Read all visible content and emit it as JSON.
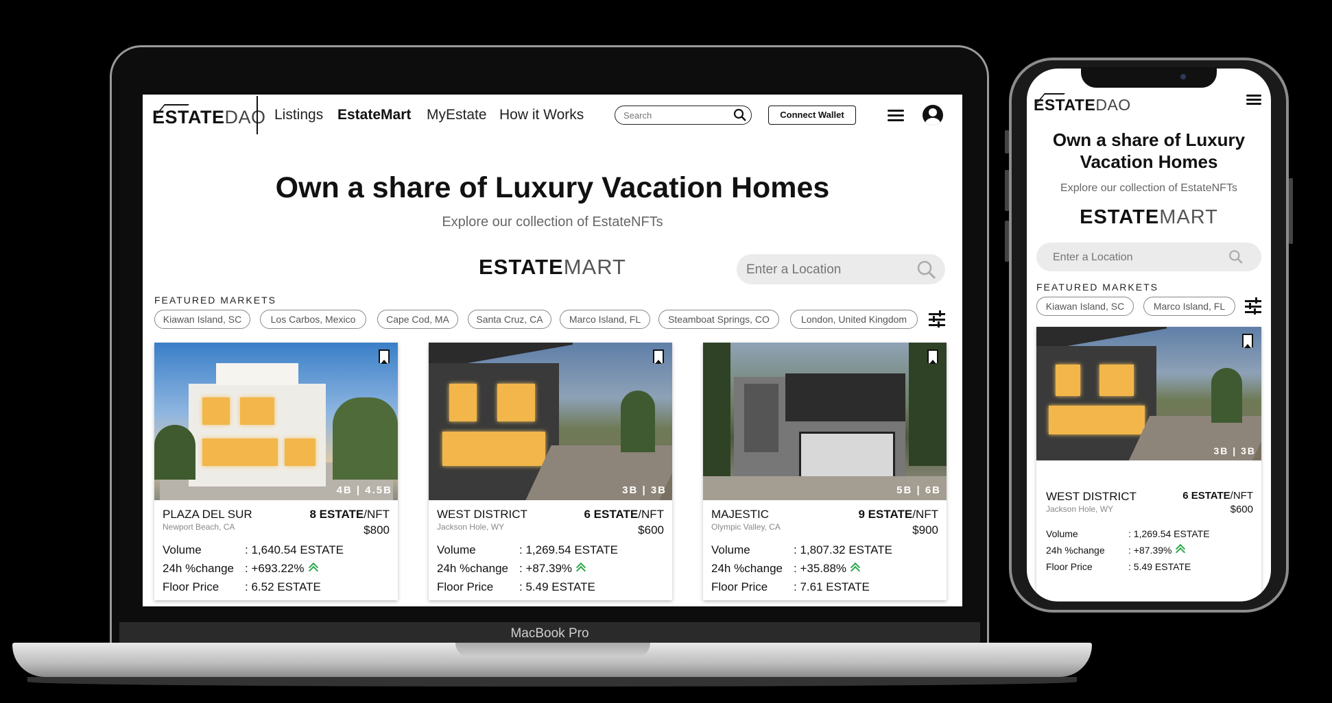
{
  "brand": {
    "bold": "ESTATE",
    "light": "DAO"
  },
  "nav": {
    "links": [
      "Listings",
      "EstateMart",
      "MyEstate",
      "How it Works"
    ],
    "active": "EstateMart",
    "search_placeholder": "Search",
    "connect_label": "Connect Wallet"
  },
  "hero": {
    "title": "Own a share of Luxury Vacation Homes",
    "title_mobile_line1": "Own a share of Luxury",
    "title_mobile_line2": "Vacation Homes",
    "subtitle": "Explore our collection of EstateNFTs"
  },
  "mart": {
    "bold": "ESTATE",
    "light": "MART"
  },
  "location_placeholder": "Enter a Location",
  "featured": {
    "label": "FEATURED MARKETS",
    "markets": [
      "Kiawan Island, SC",
      "Los Carbos, Mexico",
      "Cape Cod, MA",
      "Santa Cruz, CA",
      "Marco Island, FL",
      "Steamboat Springs, CO",
      "London, United Kingdom"
    ]
  },
  "stat_labels": {
    "volume": "Volume",
    "change": "24h %change",
    "floor": "Floor Price"
  },
  "listings": [
    {
      "name": "PLAZA DEL SUR",
      "location": "Newport Beach, CA",
      "estate": "8 ESTATE",
      "nft_suffix": "/NFT",
      "usd": "$800",
      "beds": "4B | 4.5B",
      "volume": ": 1,640.54 ESTATE",
      "change": ": +693.22%",
      "floor": ": 6.52 ESTATE"
    },
    {
      "name": "WEST DISTRICT",
      "location": "Jackson Hole, WY",
      "estate": "6 ESTATE",
      "nft_suffix": "/NFT",
      "usd": "$600",
      "beds": "3B | 3B",
      "volume": ": 1,269.54 ESTATE",
      "change": ": +87.39%",
      "floor": ": 5.49 ESTATE"
    },
    {
      "name": "MAJESTIC",
      "location": "Olympic Valley, CA",
      "estate": "9 ESTATE",
      "nft_suffix": "/NFT",
      "usd": "$900",
      "beds": "5B | 6B",
      "volume": ": 1,807.32 ESTATE",
      "change": ": +35.88%",
      "floor": ": 7.61 ESTATE"
    }
  ],
  "device_label": "MacBook Pro",
  "colors": {
    "accent_up": "#2ea84a",
    "input_bg": "#ebebeb"
  },
  "icons": [
    "search-icon",
    "hamburger-icon",
    "user-avatar-icon",
    "filter-sliders-icon",
    "bookmark-icon",
    "trend-up-icon"
  ]
}
